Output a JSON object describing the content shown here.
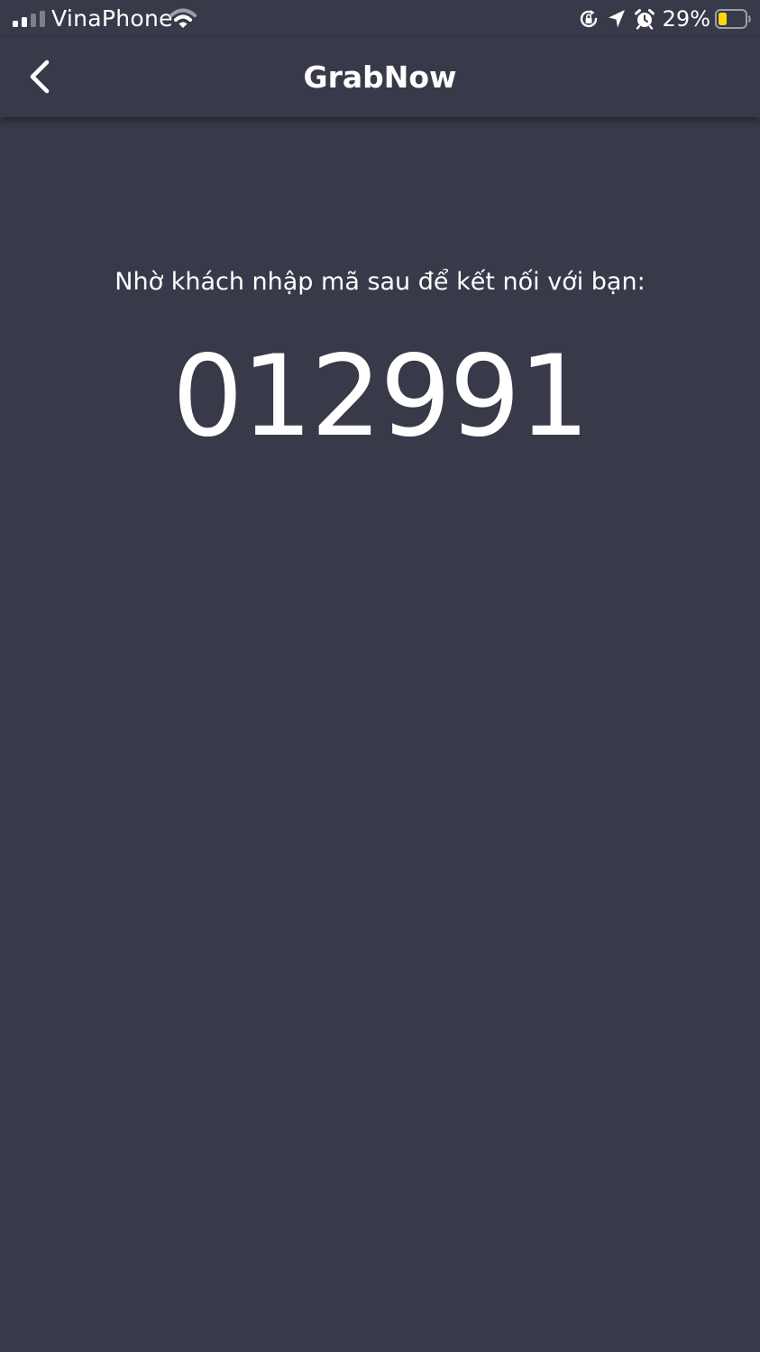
{
  "status_bar": {
    "carrier": "VinaPhone",
    "battery_percent": "29%",
    "icons": [
      "signal-icon",
      "wifi-icon",
      "orientation-lock-icon",
      "location-arrow-icon",
      "alarm-icon",
      "battery-icon"
    ],
    "battery_fill_color": "#ffd60a"
  },
  "nav": {
    "title": "GrabNow",
    "back_icon": "chevron-left-icon"
  },
  "main": {
    "instruction": "Nhờ khách nhập mã sau để kết nối với bạn:",
    "code": "012991"
  },
  "colors": {
    "background": "#383a4a",
    "text": "#ffffff"
  }
}
